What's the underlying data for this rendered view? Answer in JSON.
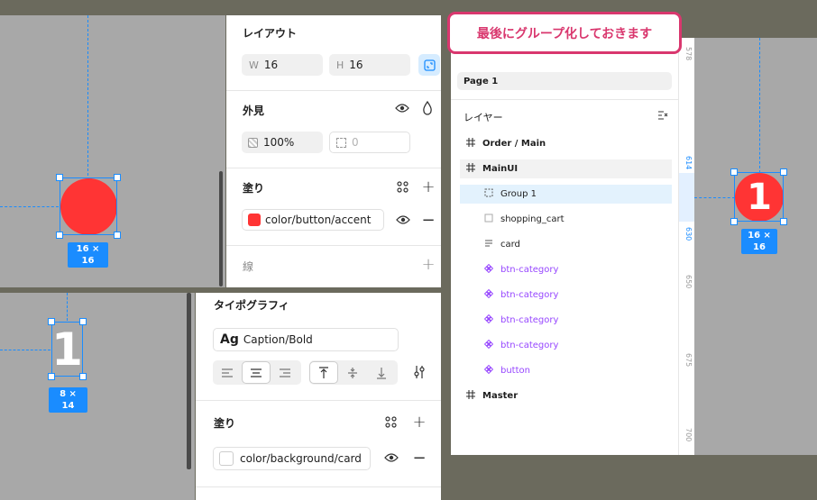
{
  "callout": {
    "text": "最後にグループ化しておきます"
  },
  "top_left": {
    "size_badge": "16 × 16",
    "layout": {
      "title": "レイアウト",
      "w_label": "W",
      "w_value": "16",
      "h_label": "H",
      "h_value": "16"
    },
    "appearance": {
      "title": "外見",
      "opacity": "100%",
      "radius": "0"
    },
    "fill": {
      "title": "塗り",
      "color_name": "color/button/accent",
      "swatch": "#ff3434"
    },
    "stroke": {
      "title": "線"
    }
  },
  "bottom_left": {
    "glyph": "1",
    "size_badge": "8 × 14",
    "typography": {
      "title": "タイポグラフィ",
      "ag": "Ag",
      "style_name": "Caption/Bold"
    },
    "fill": {
      "title": "塗り",
      "color_name": "color/background/card",
      "swatch": "#ffffff"
    }
  },
  "right": {
    "page": "Page 1",
    "layers_title": "レイヤー",
    "layers": [
      {
        "name": "Order / Main",
        "icon": "frame-icon",
        "kind": "frame"
      },
      {
        "name": "MainUI",
        "icon": "frame-icon",
        "kind": "frame"
      },
      {
        "name": "Group 1",
        "icon": "group-icon",
        "kind": "group"
      },
      {
        "name": "shopping_cart",
        "icon": "square-icon",
        "kind": "normal"
      },
      {
        "name": "card",
        "icon": "text-lines-icon",
        "kind": "normal"
      },
      {
        "name": "btn-category",
        "icon": "component-icon",
        "kind": "component"
      },
      {
        "name": "btn-category",
        "icon": "component-icon",
        "kind": "component"
      },
      {
        "name": "btn-category",
        "icon": "component-icon",
        "kind": "component"
      },
      {
        "name": "btn-category",
        "icon": "component-icon",
        "kind": "component"
      },
      {
        "name": "button",
        "icon": "component-icon",
        "kind": "component"
      },
      {
        "name": "Master",
        "icon": "frame-icon",
        "kind": "frame"
      }
    ],
    "ruler": [
      "578",
      "614",
      "630",
      "650",
      "675",
      "700"
    ],
    "badge_glyph": "1",
    "size_badge": "16 × 16"
  }
}
